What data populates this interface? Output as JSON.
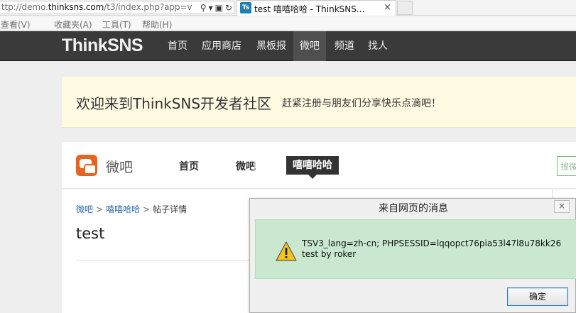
{
  "browser": {
    "address_prefix": "ttp://demo.",
    "address_domain": "thinksns.com",
    "address_suffix": "/t3/index.php?app=v",
    "search_glyph": "⚲",
    "dropdown_glyph": "▾",
    "compat_glyph": "▣",
    "refresh_glyph": "↻",
    "tab_favicon": "Ts",
    "tab_title": "test 嘻嘻哈哈 - ThinkSNS...",
    "tab_close": "×"
  },
  "menubar": {
    "items": [
      "查看(V)",
      "收藏夹(A)",
      "工具(T)",
      "帮助(H)"
    ]
  },
  "nav": {
    "logo": "ThinkSNS",
    "items": [
      "首页",
      "应用商店",
      "黑板报",
      "微吧",
      "频道",
      "找人"
    ],
    "active_index": 3
  },
  "banner": {
    "title": "欢迎来到ThinkSNS开发者社区",
    "subtitle": "赶紧注册与朋友们分享快乐点滴吧！"
  },
  "weiba": {
    "logo_text": "微吧",
    "nav": [
      "首页",
      "微吧"
    ],
    "current": "嘻嘻哈哈",
    "search_placeholder": "搜微"
  },
  "content": {
    "breadcrumb": [
      "微吧",
      "嘻嘻哈哈",
      "帖子详情"
    ],
    "breadcrumb_sep": ">",
    "post_title": "test"
  },
  "dialog": {
    "title": "来自网页的消息",
    "close_glyph": "×",
    "message_line1": "TSV3_lang=zh-cn; PHPSESSID=lqqopct76pia53l47l8u78kk26",
    "message_line2": "test by roker",
    "ok_label": "确定"
  },
  "colors": {
    "nav_bg": "#3a3a3a",
    "banner_bg": "#fffbe3",
    "dialog_body_bg": "#c9e8cf",
    "weiba_accent": "#e8631f",
    "link": "#2a6bb3"
  }
}
